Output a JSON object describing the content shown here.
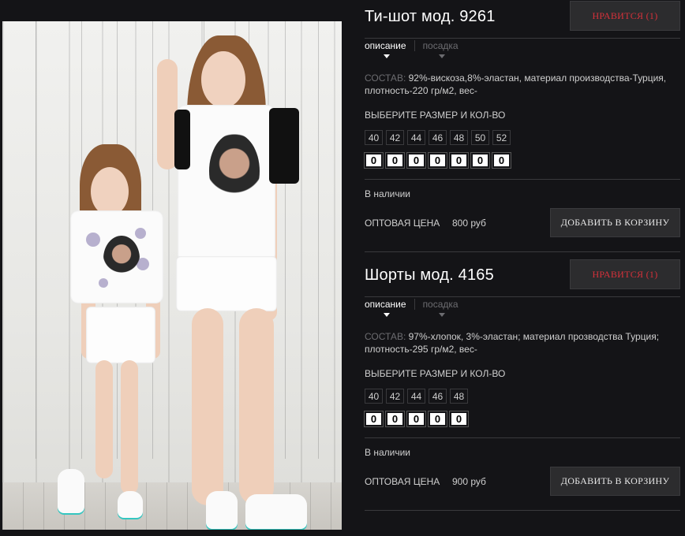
{
  "products": [
    {
      "title": "Ти-шот мод. 9261",
      "like_label": "НРАВИТСЯ (1)",
      "tabs": [
        "описание",
        "посадка"
      ],
      "composition_label": "СОСТАВ:",
      "composition_text": " 92%-вискоза,8%-эластан, материал производства-Турция, плотность-220 гр/м2, вес-",
      "size_heading": "ВЫБЕРИТЕ РАЗМЕР И КОЛ-ВО",
      "sizes": [
        "40",
        "42",
        "44",
        "46",
        "48",
        "50",
        "52"
      ],
      "quantities": [
        "0",
        "0",
        "0",
        "0",
        "0",
        "0",
        "0"
      ],
      "stock": "В наличии",
      "price_label": "ОПТОВАЯ ЦЕНА",
      "price": "800 руб",
      "cart_label": "ДОБАВИТЬ В КОРЗИНУ"
    },
    {
      "title": "Шорты мод. 4165",
      "like_label": "НРАВИТСЯ (1)",
      "tabs": [
        "описание",
        "посадка"
      ],
      "composition_label": "СОСТАВ:",
      "composition_text": " 97%-хлопок, 3%-эластан; материал прозводства Турция; плотность-295 гр/м2, вес-",
      "size_heading": "ВЫБЕРИТЕ РАЗМЕР И КОЛ-ВО",
      "sizes": [
        "40",
        "42",
        "44",
        "46",
        "48"
      ],
      "quantities": [
        "0",
        "0",
        "0",
        "0",
        "0"
      ],
      "stock": "В наличии",
      "price_label": "ОПТОВАЯ ЦЕНА",
      "price": "900 руб",
      "cart_label": "ДОБАВИТЬ В КОРЗИНУ"
    }
  ],
  "colors": {
    "background": "#141417",
    "like_text": "#d6313a",
    "button_bg": "#2c2c2e",
    "divider": "#3a3a3d",
    "muted": "#6c6c70"
  },
  "photo": {
    "icon": "product-photo-mother-daughter"
  }
}
